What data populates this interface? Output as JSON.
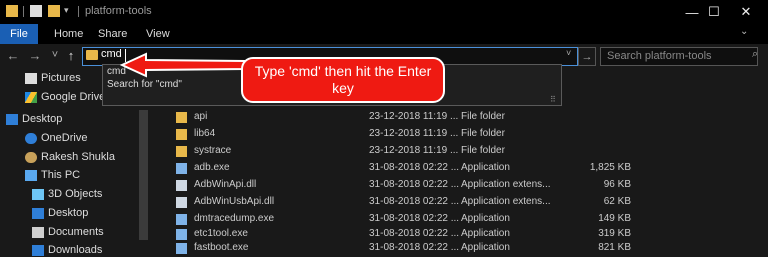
{
  "window": {
    "title": "platform-tools",
    "controls": {
      "minimize": "—",
      "maximize": "☐",
      "close": "✕"
    }
  },
  "ribbon": {
    "tabs": [
      "File",
      "Home",
      "Share",
      "View"
    ],
    "expand_icon": "chevron-down-icon"
  },
  "nav": {
    "back": "←",
    "forward": "→",
    "recent": "˅",
    "up": "↑",
    "address_value": "cmd",
    "address_dropdown": "˅",
    "go": "→",
    "search_placeholder": "Search platform-tools"
  },
  "autocomplete": {
    "items": [
      "cmd",
      "Search for \"cmd\""
    ]
  },
  "callout": {
    "text": "Type 'cmd' then hit the Enter key",
    "color": "#ef1a12"
  },
  "sidebar": {
    "items": [
      {
        "label": "Pictures",
        "icon": "pictures-icon"
      },
      {
        "label": "Google Drive",
        "icon": "google-drive-icon"
      },
      {
        "label": "Desktop",
        "icon": "desktop-icon"
      },
      {
        "label": "OneDrive",
        "icon": "onedrive-icon"
      },
      {
        "label": "Rakesh Shukla",
        "icon": "user-icon"
      },
      {
        "label": "This PC",
        "icon": "computer-icon"
      },
      {
        "label": "3D Objects",
        "icon": "3d-objects-icon"
      },
      {
        "label": "Desktop",
        "icon": "desktop-icon"
      },
      {
        "label": "Documents",
        "icon": "documents-icon"
      },
      {
        "label": "Downloads",
        "icon": "downloads-icon"
      }
    ]
  },
  "file_list": {
    "column_fragment": "ze",
    "rows": [
      {
        "name": "api",
        "date": "23-12-2018 11:19 ...",
        "type": "File folder",
        "size": "",
        "kind": "folder"
      },
      {
        "name": "lib64",
        "date": "23-12-2018 11:19 ...",
        "type": "File folder",
        "size": "",
        "kind": "folder"
      },
      {
        "name": "systrace",
        "date": "23-12-2018 11:19 ...",
        "type": "File folder",
        "size": "",
        "kind": "folder"
      },
      {
        "name": "adb.exe",
        "date": "31-08-2018 02:22 ...",
        "type": "Application",
        "size": "1,825 KB",
        "kind": "exe"
      },
      {
        "name": "AdbWinApi.dll",
        "date": "31-08-2018 02:22 ...",
        "type": "Application extens...",
        "size": "96 KB",
        "kind": "dll"
      },
      {
        "name": "AdbWinUsbApi.dll",
        "date": "31-08-2018 02:22 ...",
        "type": "Application extens...",
        "size": "62 KB",
        "kind": "dll"
      },
      {
        "name": "dmtracedump.exe",
        "date": "31-08-2018 02:22 ...",
        "type": "Application",
        "size": "149 KB",
        "kind": "exe"
      },
      {
        "name": "etc1tool.exe",
        "date": "31-08-2018 02:22 ...",
        "type": "Application",
        "size": "319 KB",
        "kind": "exe"
      },
      {
        "name": "fastboot.exe",
        "date": "31-08-2018 02:22 ...",
        "type": "Application",
        "size": "821 KB",
        "kind": "exe"
      }
    ]
  }
}
